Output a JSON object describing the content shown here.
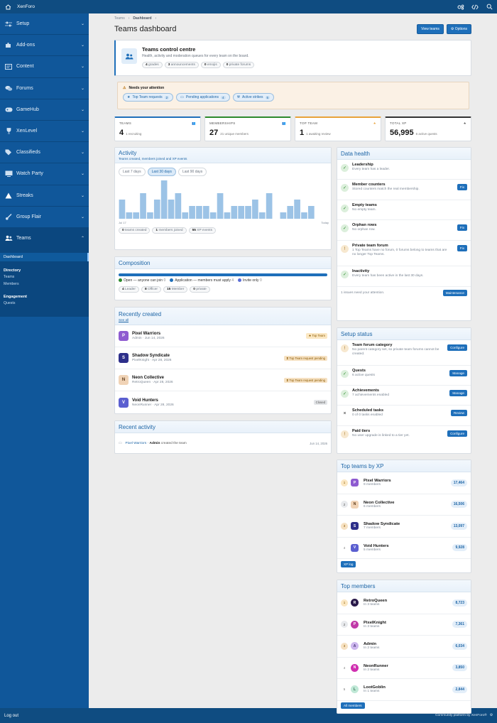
{
  "app": {
    "brand": "XenForo"
  },
  "sidebar": {
    "items": [
      {
        "label": "Setup",
        "icon": "sliders-icon"
      },
      {
        "label": "Add-ons",
        "icon": "puzzle-icon"
      },
      {
        "label": "Content",
        "icon": "content-icon"
      },
      {
        "label": "Forums",
        "icon": "comments-icon"
      },
      {
        "label": "GameHub",
        "icon": "gamepad-icon"
      },
      {
        "label": "XenLevel",
        "icon": "trophy-icon"
      },
      {
        "label": "Classifieds",
        "icon": "tags-icon"
      },
      {
        "label": "Watch Party",
        "icon": "tv-icon"
      },
      {
        "label": "Streaks",
        "icon": "triangle-icon"
      },
      {
        "label": "Group Flair",
        "icon": "brush-icon"
      },
      {
        "label": "Teams",
        "icon": "users-icon"
      }
    ],
    "sub": {
      "dashboard": "Dashboard",
      "directory_header": "Directory",
      "teams": "Teams",
      "members": "Members",
      "engagement_header": "Engagement",
      "quests": "Quests"
    },
    "logout": "Log out",
    "copyright": "Community platform by XenForo®"
  },
  "breadcrumb": {
    "root": "Teams",
    "current": "Dashboard"
  },
  "page": {
    "title": "Teams dashboard",
    "view_teams": "View teams",
    "options": "Options"
  },
  "control": {
    "title": "Teams control centre",
    "subtitle": "Health, activity and moderation queues for every team on the board.",
    "pills": [
      {
        "n": "4",
        "t": "grades"
      },
      {
        "n": "3",
        "t": "announcements"
      },
      {
        "n": "0",
        "t": "emojis"
      },
      {
        "n": "0",
        "t": "private forums"
      }
    ]
  },
  "attention": {
    "title": "Needs your attention",
    "items": [
      {
        "label": "Top Team requests",
        "count": "2"
      },
      {
        "label": "Pending applications",
        "count": "4"
      },
      {
        "label": "Active strikes",
        "count": "5"
      }
    ]
  },
  "stats": [
    {
      "label": "TEAMS",
      "value": "4",
      "note": "1 recruiting",
      "color": "#1e6fba"
    },
    {
      "label": "MEMBERSHIPS",
      "value": "27",
      "note": "21 unique members",
      "color": "#2c8a2c"
    },
    {
      "label": "TOP TEAM",
      "value": "1",
      "note": "1 awaiting review",
      "color": "#e8a23a"
    },
    {
      "label": "TOTAL XP",
      "value": "56,995",
      "note": "6 active quests",
      "color": "#333333"
    }
  ],
  "activity": {
    "title": "Activity",
    "subtitle": "Teams created, members joined and XP events",
    "ranges": [
      "Last 7 days",
      "Last 30 days",
      "Last 90 days"
    ],
    "selected_range": "Last 30 days",
    "x_start": "Jul 17",
    "x_end": "Today",
    "pills": [
      {
        "n": "0",
        "t": "teams created"
      },
      {
        "n": "1",
        "t": "members joined"
      },
      {
        "n": "55",
        "t": "XP events"
      }
    ]
  },
  "chart_data": {
    "type": "bar",
    "title": "Activity",
    "values": [
      3,
      1,
      1,
      4,
      1,
      3,
      6,
      3,
      4,
      1,
      2,
      2,
      2,
      1,
      4,
      1,
      2,
      2,
      2,
      3,
      1,
      4,
      0,
      1,
      2,
      3,
      1,
      2,
      0,
      0
    ]
  },
  "composition": {
    "title": "Composition",
    "legend": [
      {
        "label": "Open — anyone can join",
        "n": "0",
        "color": "#2c8a2c"
      },
      {
        "label": "Application — members must apply",
        "n": "4",
        "color": "#1e6fba"
      },
      {
        "label": "Invite only",
        "n": "0",
        "color": "#5b6dd6"
      }
    ],
    "pills": [
      {
        "n": "4",
        "t": "Leader"
      },
      {
        "n": "8",
        "t": "Officer"
      },
      {
        "n": "15",
        "t": "Member"
      },
      {
        "n": "0",
        "t": "private"
      }
    ]
  },
  "recent": {
    "title": "Recently created",
    "see_all": "See all",
    "rows": [
      {
        "initial": "P",
        "name": "Pixel Warriors",
        "meta": "Admin · Jun 14, 2026",
        "tag": "Top Team",
        "tag_color": "#8a5a00",
        "tag_bg": "#fbe7c2",
        "av": "#8e5bd0"
      },
      {
        "initial": "S",
        "name": "Shadow Syndicate",
        "meta": "PixelKnight · Apr 28, 2026",
        "tag": "Top Team request pending",
        "tag_color": "#8a5a00",
        "tag_bg": "#f6e1c2",
        "av": "#2d2f8a"
      },
      {
        "initial": "N",
        "name": "Neon Collective",
        "meta": "RetroQueen · Apr 28, 2026",
        "tag": "Top Team request pending",
        "tag_color": "#8a5a00",
        "tag_bg": "#f6e1c2",
        "av": "#f0d3b6"
      },
      {
        "initial": "V",
        "name": "Void Hunters",
        "meta": "NeonRunner · Apr 28, 2026",
        "tag": "Closed",
        "tag_color": "#555555",
        "tag_bg": "#e3e5e8",
        "av": "#5b5fd0"
      }
    ]
  },
  "recent_activity": {
    "title": "Recent activity",
    "team": "Pixel Warriors",
    "sep": "·",
    "user": "Admin",
    "action": "created the team",
    "date": "Jun 14, 2026"
  },
  "health": {
    "title": "Data health",
    "rows": [
      {
        "status": "ok",
        "name": "Leadership",
        "desc": "Every team has a leader.",
        "btn": ""
      },
      {
        "status": "ok",
        "name": "Member counters",
        "desc": "Stored counters match the real membership.",
        "btn": "Fix"
      },
      {
        "status": "ok",
        "name": "Empty teams",
        "desc": "No empty team.",
        "btn": ""
      },
      {
        "status": "ok",
        "name": "Orphan rows",
        "desc": "No orphan row.",
        "btn": "Fix"
      },
      {
        "status": "warn",
        "name": "Private team forum",
        "desc": "1 Top Teams have no forum, 0 forums belong to teams that are no longer Top Teams.",
        "btn": "Fix"
      },
      {
        "status": "ok",
        "name": "Inactivity",
        "desc": "Every team has been active in the last 30 days.",
        "btn": ""
      }
    ],
    "footer": "1 issues need your attention.",
    "maintenance": "Maintenance"
  },
  "setup": {
    "title": "Setup status",
    "rows": [
      {
        "status": "warn",
        "name": "Team forum category",
        "desc": "No parent category set, so private team forums cannot be created.",
        "btn": "Configure"
      },
      {
        "status": "ok",
        "name": "Quests",
        "desc": "6 active quests",
        "btn": "Manage"
      },
      {
        "status": "ok",
        "name": "Achievements",
        "desc": "7 achievements enabled",
        "btn": "Manage"
      },
      {
        "status": "x",
        "name": "Scheduled tasks",
        "desc": "0 of 0 tasks enabled",
        "btn": "Review"
      },
      {
        "status": "warn",
        "name": "Paid tiers",
        "desc": "No user upgrade is linked to a tier yet.",
        "btn": "Configure"
      }
    ]
  },
  "top_xp": {
    "title": "Top teams by XP",
    "rows": [
      {
        "rank": "1",
        "initial": "P",
        "name": "Pixel Warriors",
        "sub": "9 members",
        "xp": "17,464",
        "av": "#8e5bd0"
      },
      {
        "rank": "2",
        "initial": "N",
        "name": "Neon Collective",
        "sub": "6 members",
        "xp": "16,506",
        "av": "#f0d3b6"
      },
      {
        "rank": "3",
        "initial": "S",
        "name": "Shadow Syndicate",
        "sub": "7 members",
        "xp": "13,097",
        "av": "#2d2f8a"
      },
      {
        "rank": "4",
        "initial": "V",
        "name": "Void Hunters",
        "sub": "5 members",
        "xp": "9,928",
        "av": "#5b5fd0"
      }
    ],
    "button": "XP log"
  },
  "top_members": {
    "title": "Top members",
    "rows": [
      {
        "rank": "1",
        "initial": "R",
        "name": "RetroQueen",
        "sub": "In 3 teams",
        "xp": "8,723",
        "av": "#2a1a4a"
      },
      {
        "rank": "2",
        "initial": "P",
        "name": "PixelKnight",
        "sub": "In 3 teams",
        "xp": "7,361",
        "av": "#c03aa8"
      },
      {
        "rank": "3",
        "initial": "A",
        "name": "Admin",
        "sub": "In 2 teams",
        "xp": "6,034",
        "av": "#cdb7ee"
      },
      {
        "rank": "4",
        "initial": "N",
        "name": "NeonRunner",
        "sub": "In 2 teams",
        "xp": "3,850",
        "av": "#d02fb0"
      },
      {
        "rank": "5",
        "initial": "L",
        "name": "LootGoblin",
        "sub": "In 1 teams",
        "xp": "2,844",
        "av": "#bfe8d6"
      }
    ],
    "button": "All members"
  }
}
